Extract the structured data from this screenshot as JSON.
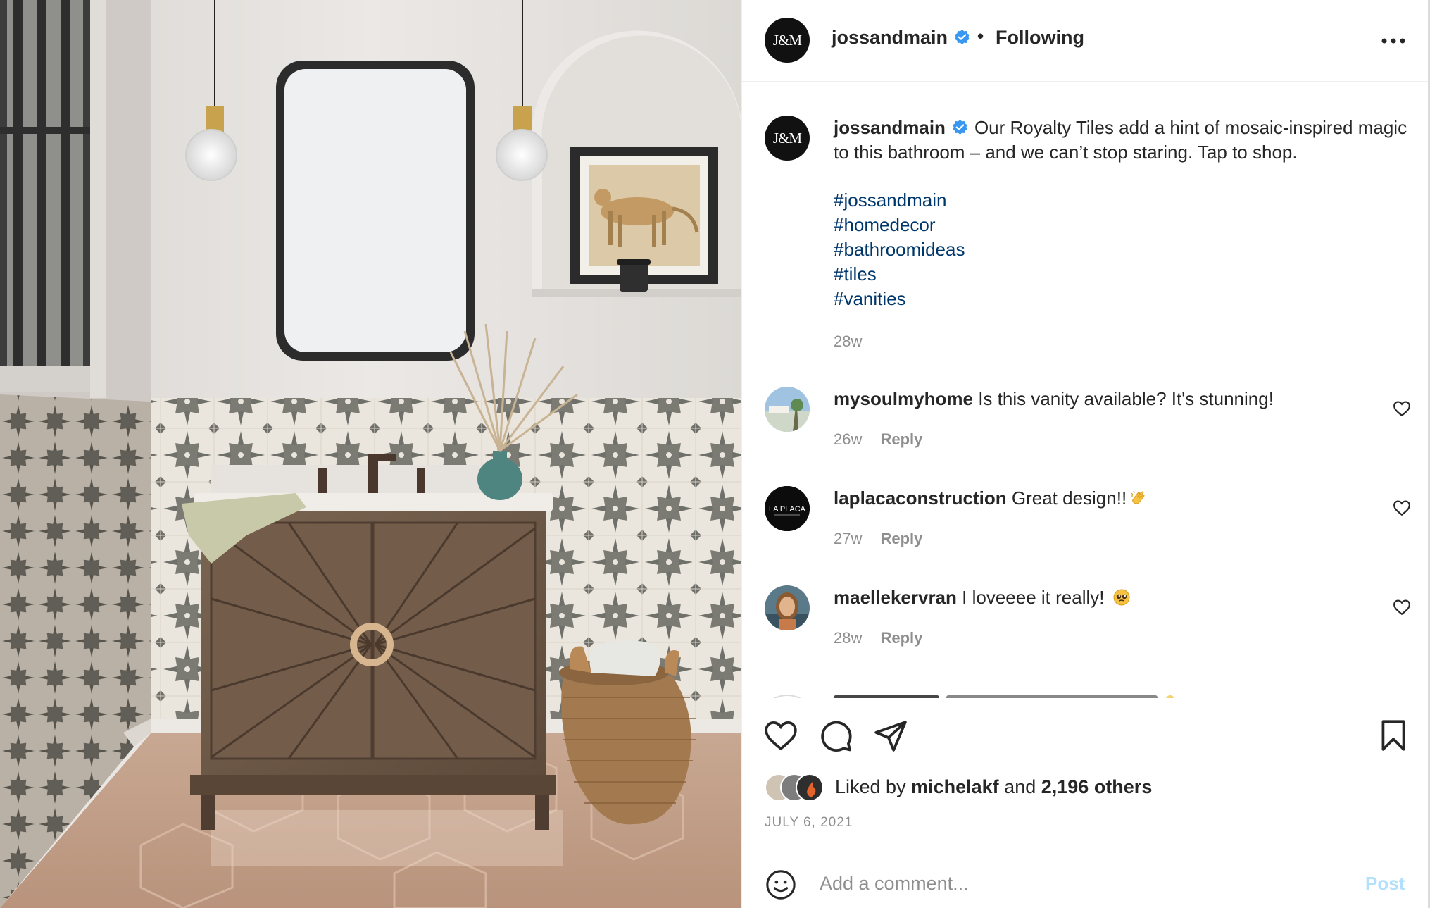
{
  "post": {
    "author": "jossandmain",
    "avatar_text": "J&M",
    "follow_status": "Following",
    "separator": "•",
    "more_icon": "more-horizontal-icon",
    "verified_icon": "verified-badge-icon"
  },
  "caption": {
    "username": "jossandmain",
    "text": "Our Royalty Tiles add a hint of mosaic-inspired magic to this bathroom – and we can’t stop staring. Tap to shop.",
    "hashtags": [
      "#jossandmain",
      "#homedecor",
      "#bathroomideas",
      "#tiles",
      "#vanities"
    ],
    "time": "28w"
  },
  "comments": [
    {
      "username": "mysoulmyhome",
      "text": "Is this vanity available? It's stunning!",
      "emoji": "",
      "time": "26w",
      "reply": "Reply"
    },
    {
      "username": "laplacaconstruction",
      "text": "Great design!!",
      "emoji": "clapping-hands-icon",
      "avatar_text": "LA PLACA",
      "time": "27w",
      "reply": "Reply"
    },
    {
      "username": "maellekervran",
      "text": "I loveeee it really! ",
      "emoji": "pleading-face-icon",
      "time": "28w",
      "reply": "Reply"
    }
  ],
  "engagement": {
    "liked_by_prefix": "Liked by",
    "liked_by_user": "michelakf",
    "and": "and",
    "others": "2,196 others",
    "date": "JULY 6, 2021"
  },
  "comment_box": {
    "placeholder": "Add a comment...",
    "post_label": "Post"
  },
  "colors": {
    "link": "#00376b",
    "muted": "#8e8e8e",
    "verified": "#3897f0",
    "post_disabled": "#b2dffc",
    "text": "#262626"
  }
}
